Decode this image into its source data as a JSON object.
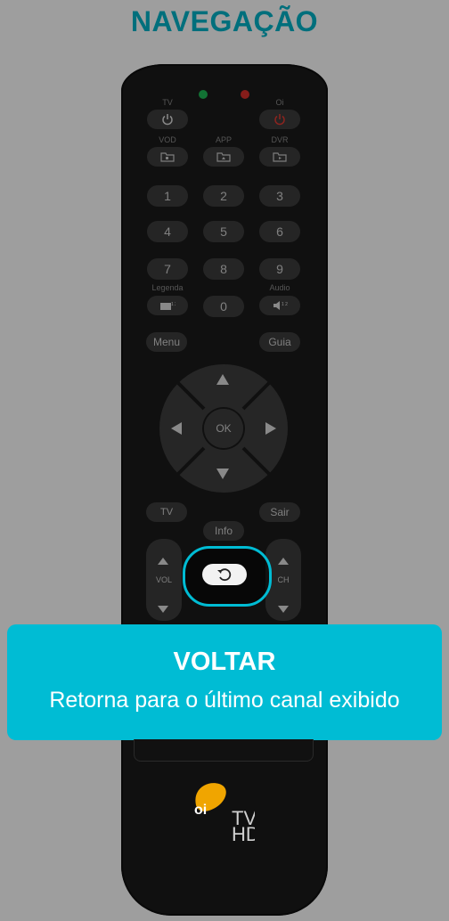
{
  "title": "NAVEGAÇÃO",
  "remote": {
    "labels": {
      "tv": "TV",
      "oi": "Oi",
      "vod": "VOD",
      "app": "APP",
      "dvr": "DVR",
      "legenda": "Legenda",
      "audio": "Audio"
    },
    "numbers": [
      "1",
      "2",
      "3",
      "4",
      "5",
      "6",
      "7",
      "8",
      "9",
      "0"
    ],
    "menu": "Menu",
    "guia": "Guia",
    "ok": "OK",
    "sair": "Sair",
    "tv_mini": "TV",
    "info": "Info",
    "vol": "VOL",
    "ch": "CH",
    "logo_tv": "TV",
    "logo_hd": "HD",
    "logo_oi": "oi"
  },
  "colors": {
    "accent": "#00bcd4",
    "title": "#00b4c8",
    "led_green": "#1db954",
    "led_red": "#d9302b"
  },
  "callout": {
    "heading": "VOLTAR",
    "description": "Retorna para o último canal exibido"
  }
}
